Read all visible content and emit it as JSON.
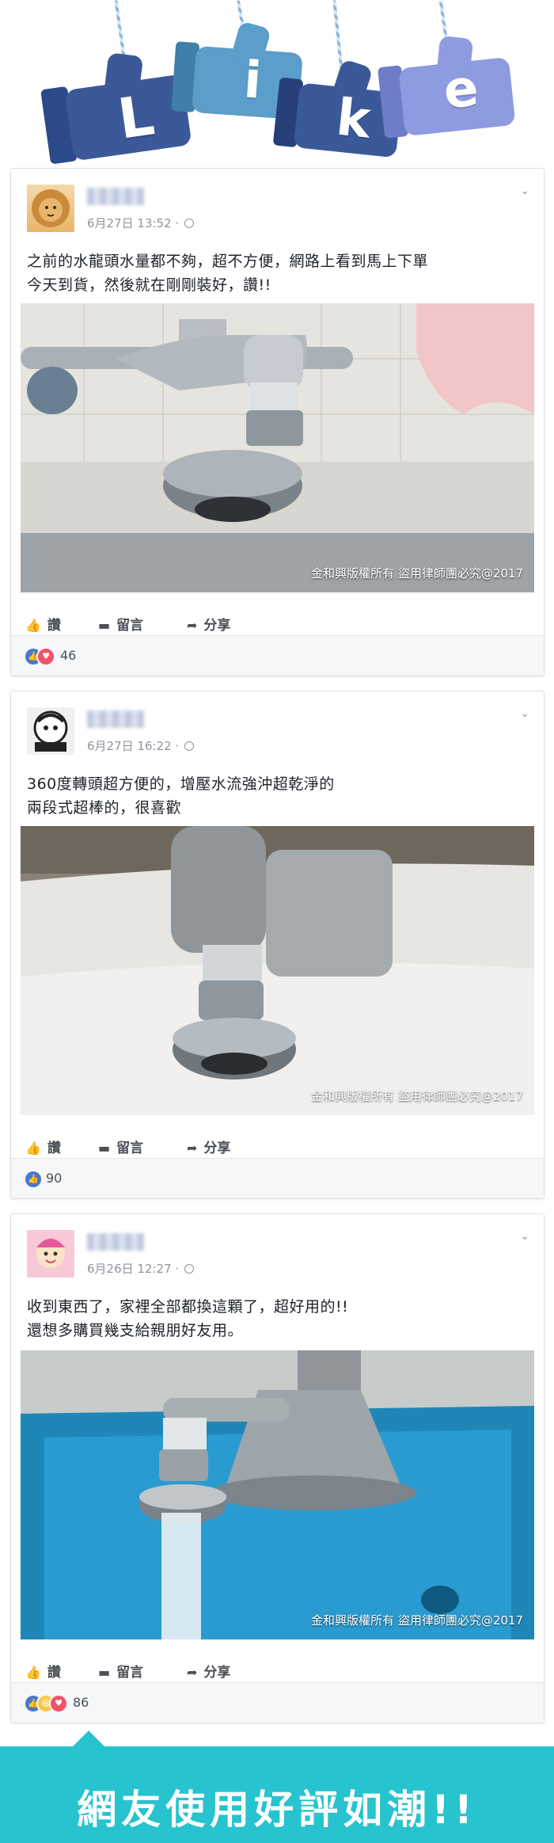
{
  "banner": {
    "letters": [
      "L",
      "i",
      "k",
      "e"
    ]
  },
  "actions": {
    "like": "讚",
    "comment": "留言",
    "share": "分享"
  },
  "posts": [
    {
      "date": "6月27日 13:52 ·",
      "line1": "之前的水龍頭水量都不夠，超不方便，網路上看到馬上下單",
      "line2": "今天到貨，然後就在剛剛裝好，讚!!",
      "watermark": "金和興版權所有 盜用律師團必究@2017",
      "reactions": [
        "like-reaction-icon",
        "love-reaction-icon"
      ],
      "count": "46"
    },
    {
      "date": "6月27日 16:22 ·",
      "line1": "360度轉頭超方便的，增壓水流強沖超乾淨的",
      "line2": "兩段式超棒的，很喜歡",
      "watermark": "金和興版權所有 盜用律師團必究@2017",
      "reactions": [
        "like-reaction-icon"
      ],
      "count": "90"
    },
    {
      "date": "6月26日 12:27 ·",
      "line1": "收到東西了，家裡全部都換這顆了，超好用的!!",
      "line2": "還想多購買幾支給親朋好友用。",
      "watermark": "金和興版權所有 盜用律師團必究@2017",
      "reactions": [
        "like-reaction-icon",
        "haha-reaction-icon",
        "love-reaction-icon"
      ],
      "count": "86"
    }
  ],
  "footer": {
    "text": "網友使用好評如潮!!"
  },
  "colors": {
    "thumb_blue": "#3b5998",
    "thumb_light": "#6f8fd0",
    "thumb_teal": "#5a9ec9",
    "thumb_lavender": "#8e9be0",
    "footer_bg": "#27c3cf",
    "like_blue": "#4a78c8",
    "love_red": "#f25268",
    "haha_yellow": "#f7c948"
  }
}
